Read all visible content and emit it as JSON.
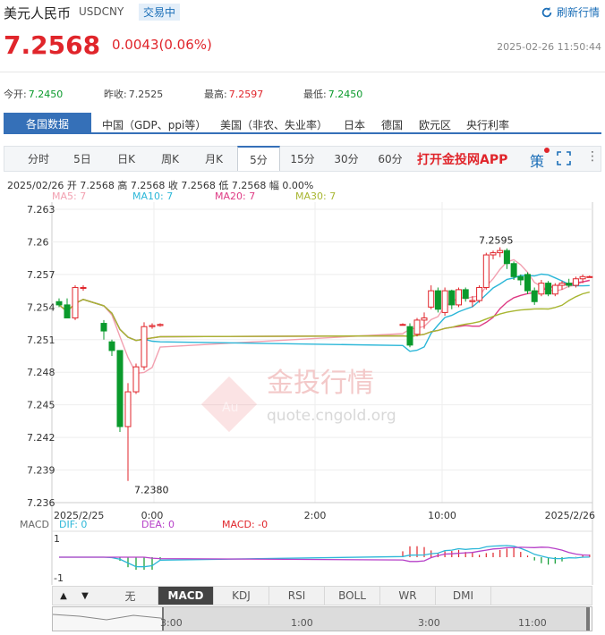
{
  "header": {
    "title": "美元人民币",
    "code": "USDCNY",
    "status": "交易中",
    "refresh_label": "刷新行情",
    "price": "7.2568",
    "change": "0.0043(0.06%)",
    "datetime": "2025-02-26 11:50:44"
  },
  "stats": [
    {
      "label": "今开:",
      "value": "7.2450",
      "color": "#0a9a2c"
    },
    {
      "label": "昨收:",
      "value": "7.2525",
      "color": "#333333"
    },
    {
      "label": "最高:",
      "value": "7.2597",
      "color": "#e0252b"
    },
    {
      "label": "最低:",
      "value": "7.2450",
      "color": "#0a9a2c"
    }
  ],
  "category_tabs": {
    "active": "各国数据",
    "items": [
      "中国（GDP、ppi等）",
      "美国（非农、失业率）",
      "日本",
      "德国",
      "欧元区",
      "央行利率"
    ]
  },
  "periods": {
    "items": [
      "分时",
      "5日",
      "日K",
      "周K",
      "月K",
      "5分",
      "15分",
      "30分",
      "60分"
    ],
    "active_index": 5,
    "app_link": "打开金投网APP",
    "strategy": "策",
    "icons": [
      "fullscreen-icon",
      "more-icon"
    ]
  },
  "ohlc_line": "2025/02/26  开 7.2568  高 7.2568  收 7.2568  低 7.2568  幅 0.00%",
  "ma_legend": [
    {
      "label": "MA5: 7",
      "color": "#f2a0b0"
    },
    {
      "label": "MA10: 7",
      "color": "#2cb7d8"
    },
    {
      "label": "MA20: 7",
      "color": "#de3a84"
    },
    {
      "label": "MA30: 7",
      "color": "#a8b631"
    }
  ],
  "watermark": {
    "text": "金投行情",
    "url": "quote.cngold.org"
  },
  "macd_legend": {
    "name": "MACD",
    "dif": "DIF: 0",
    "dea": "DEA: 0",
    "macd": "MACD: -0"
  },
  "indicator_tabs": {
    "items": [
      "无",
      "MACD",
      "KDJ",
      "RSI",
      "BOLL",
      "WR",
      "DMI"
    ],
    "active_index": 1,
    "up": "▲",
    "down": "▼"
  },
  "navigator_labels": [
    "3:00",
    "1:00",
    "3:00",
    "11:00"
  ],
  "chart_data": {
    "type": "candlestick",
    "ylim": [
      7.236,
      7.263
    ],
    "yticks": [
      "7.263",
      "7.26",
      "7.257",
      "7.254",
      "7.251",
      "7.248",
      "7.245",
      "7.242",
      "7.239",
      "7.236"
    ],
    "xticks": [
      "2025/2/25",
      "0:00",
      "2:00",
      "10:00",
      "2025/2/26"
    ],
    "annotations": [
      "7.2595",
      "7.2380"
    ],
    "macd_yticks": [
      "1",
      "-1"
    ],
    "colors": {
      "up": "#e0252b",
      "down": "#0a9a2c"
    },
    "candles": [
      {
        "o": 7.2545,
        "h": 7.2548,
        "l": 7.254,
        "c": 7.2542
      },
      {
        "o": 7.2542,
        "h": 7.2548,
        "l": 7.253,
        "c": 7.253
      },
      {
        "o": 7.253,
        "h": 7.256,
        "l": 7.2528,
        "c": 7.2558
      },
      {
        "o": 7.2558,
        "h": 7.256,
        "l": 7.2555,
        "c": 7.2558
      },
      {
        "o": 7.2525,
        "h": 7.2528,
        "l": 7.251,
        "c": 7.2518
      },
      {
        "o": 7.2508,
        "h": 7.251,
        "l": 7.2495,
        "c": 7.25
      },
      {
        "o": 7.25,
        "h": 7.25,
        "l": 7.2425,
        "c": 7.243
      },
      {
        "o": 7.243,
        "h": 7.247,
        "l": 7.238,
        "c": 7.2462
      },
      {
        "o": 7.2462,
        "h": 7.2488,
        "l": 7.246,
        "c": 7.2485
      },
      {
        "o": 7.2485,
        "h": 7.2526,
        "l": 7.2482,
        "c": 7.2522
      },
      {
        "o": 7.2522,
        "h": 7.2525,
        "l": 7.252,
        "c": 7.2523
      },
      {
        "o": 7.2523,
        "h": 7.2525,
        "l": 7.2522,
        "c": 7.2524
      },
      {
        "o": 7.2524,
        "h": 7.2525,
        "l": 7.2523,
        "c": 7.2524
      },
      {
        "o": 7.2522,
        "h": 7.2525,
        "l": 7.2503,
        "c": 7.2505
      },
      {
        "o": 7.2515,
        "h": 7.253,
        "l": 7.2513,
        "c": 7.2528
      },
      {
        "o": 7.2528,
        "h": 7.2535,
        "l": 7.252,
        "c": 7.253
      },
      {
        "o": 7.254,
        "h": 7.256,
        "l": 7.2538,
        "c": 7.2555
      },
      {
        "o": 7.2555,
        "h": 7.2558,
        "l": 7.2535,
        "c": 7.2538
      },
      {
        "o": 7.2535,
        "h": 7.2558,
        "l": 7.2532,
        "c": 7.2555
      },
      {
        "o": 7.2555,
        "h": 7.2556,
        "l": 7.2538,
        "c": 7.2542
      },
      {
        "o": 7.2542,
        "h": 7.2558,
        "l": 7.254,
        "c": 7.2556
      },
      {
        "o": 7.2556,
        "h": 7.2558,
        "l": 7.2545,
        "c": 7.2548
      },
      {
        "o": 7.2545,
        "h": 7.255,
        "l": 7.254,
        "c": 7.2546
      },
      {
        "o": 7.2546,
        "h": 7.256,
        "l": 7.2544,
        "c": 7.2558
      },
      {
        "o": 7.2558,
        "h": 7.259,
        "l": 7.2556,
        "c": 7.2588
      },
      {
        "o": 7.2588,
        "h": 7.2592,
        "l": 7.2584,
        "c": 7.259
      },
      {
        "o": 7.259,
        "h": 7.2595,
        "l": 7.2586,
        "c": 7.2592
      },
      {
        "o": 7.2592,
        "h": 7.2594,
        "l": 7.2575,
        "c": 7.258
      },
      {
        "o": 7.258,
        "h": 7.2582,
        "l": 7.2565,
        "c": 7.2568
      },
      {
        "o": 7.2568,
        "h": 7.257,
        "l": 7.256,
        "c": 7.2565
      },
      {
        "o": 7.257,
        "h": 7.2572,
        "l": 7.2552,
        "c": 7.2555
      },
      {
        "o": 7.2555,
        "h": 7.2558,
        "l": 7.2542,
        "c": 7.2545
      },
      {
        "o": 7.2552,
        "h": 7.2565,
        "l": 7.255,
        "c": 7.2562
      },
      {
        "o": 7.2562,
        "h": 7.2564,
        "l": 7.255,
        "c": 7.2552
      },
      {
        "o": 7.2552,
        "h": 7.2562,
        "l": 7.255,
        "c": 7.256
      },
      {
        "o": 7.256,
        "h": 7.2564,
        "l": 7.2556,
        "c": 7.2562
      },
      {
        "o": 7.2562,
        "h": 7.2566,
        "l": 7.2558,
        "c": 7.256
      },
      {
        "o": 7.256,
        "h": 7.2568,
        "l": 7.2558,
        "c": 7.2566
      },
      {
        "o": 7.2566,
        "h": 7.257,
        "l": 7.2562,
        "c": 7.2568
      },
      {
        "o": 7.2568,
        "h": 7.2569,
        "l": 7.2567,
        "c": 7.2568
      }
    ]
  }
}
